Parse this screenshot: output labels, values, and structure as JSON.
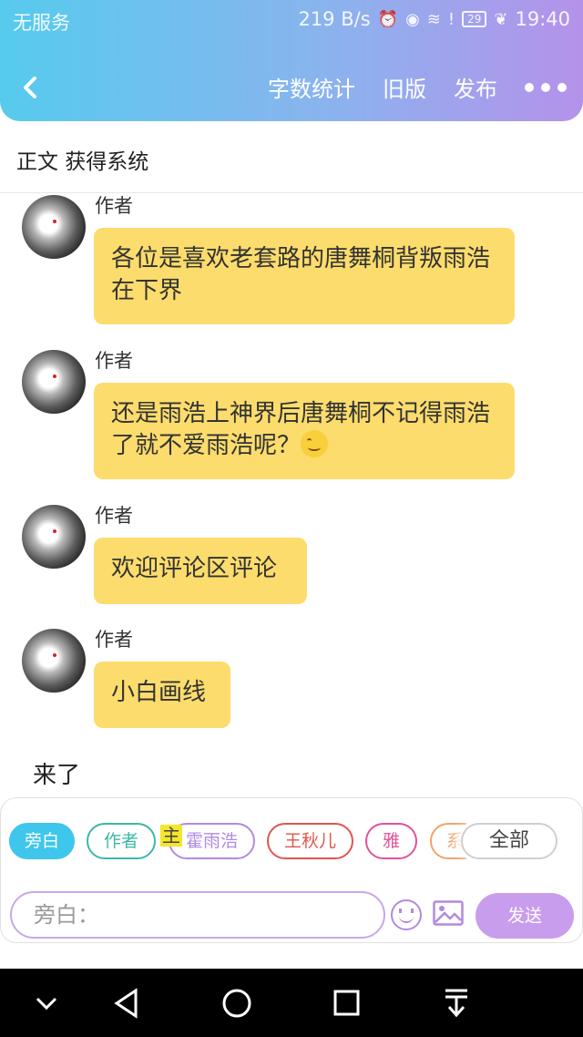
{
  "status": {
    "carrier": "无服务",
    "speed": "219 B/s",
    "battery": "29",
    "time": "19:40"
  },
  "header": {
    "actions": {
      "word_count": "字数统计",
      "old_version": "旧版",
      "publish": "发布"
    }
  },
  "subtitle": "正文 获得系统",
  "messages": [
    {
      "author": "作者",
      "text": "各位是喜欢老套路的唐舞桐背叛雨浩在下界"
    },
    {
      "author": "作者",
      "text": "还是雨浩上神界后唐舞桐不记得雨浩了就不爱雨浩呢？",
      "emoji": "smiling-face"
    },
    {
      "author": "作者",
      "text": "欢迎评论区评论"
    },
    {
      "author": "作者",
      "text": "小白画线"
    }
  ],
  "narration": "来了",
  "roles": {
    "items": [
      "旁白",
      "作者",
      "霍雨浩",
      "王秋儿",
      "雅",
      "系"
    ],
    "marker": "主",
    "all": "全部",
    "colors": {
      "narrator": "#3ec6ec",
      "author": "#3bb8a6",
      "huo": "#b28ae0",
      "wang": "#e0564f",
      "ya": "#e05498",
      "sys": "#f2a36a"
    }
  },
  "input": {
    "placeholder": "旁白："
  },
  "send_label": "发送",
  "icons": [
    "back-arrow-icon",
    "more-dots-icon",
    "emoji-icon",
    "image-icon",
    "nav-down-icon",
    "nav-back-icon",
    "nav-home-icon",
    "nav-recents-icon",
    "nav-notification-icon"
  ]
}
